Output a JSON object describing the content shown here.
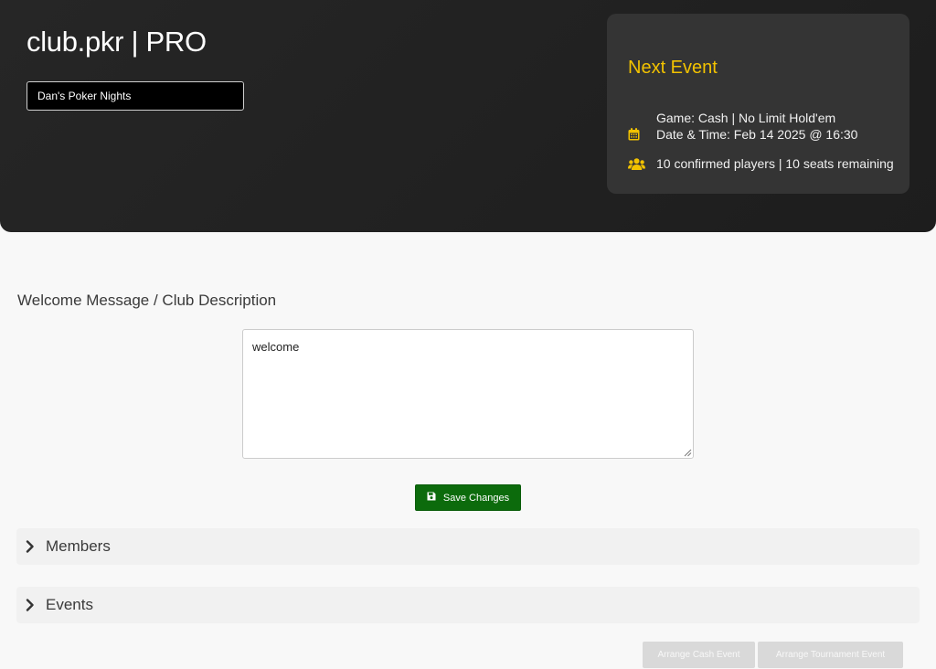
{
  "header": {
    "app_title": "club.pkr | PRO",
    "club_selector": {
      "selected": "Dan's Poker Nights"
    }
  },
  "next_event": {
    "title": "Next Event",
    "game": "Game: Cash | No Limit Hold'em",
    "date_time": "Date & Time: Feb 14 2025 @ 16:30",
    "players": "10 confirmed players | 10 seats remaining",
    "icons": {
      "date": "calendar-icon",
      "players": "users-icon"
    },
    "accent_color": "#f2c200"
  },
  "welcome": {
    "label": "Welcome Message / Club Description",
    "value": "welcome"
  },
  "save_button": {
    "label": "Save Changes",
    "icon": "floppy-disk-icon",
    "color": "#0c6b0c"
  },
  "accordions": [
    {
      "label": "Members",
      "icon": "chevron-right-icon"
    },
    {
      "label": "Events",
      "icon": "chevron-right-icon"
    }
  ],
  "event_buttons": {
    "cash": "Arrange Cash Event",
    "tournament": "Arrange Tournament Event"
  }
}
